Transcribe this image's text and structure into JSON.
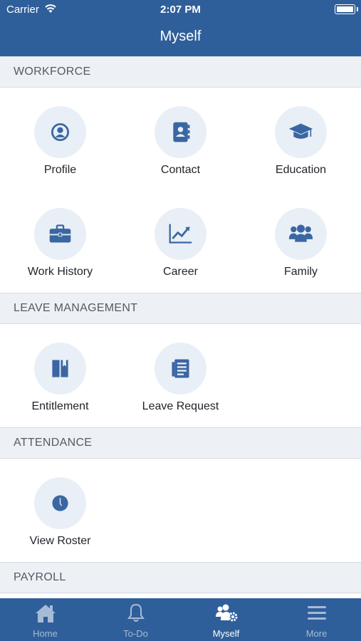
{
  "status_bar": {
    "carrier": "Carrier",
    "time": "2:07 PM"
  },
  "header": {
    "title": "Myself"
  },
  "sections": [
    {
      "title": "WORKFORCE",
      "items": [
        {
          "label": "Profile",
          "icon": "profile-icon"
        },
        {
          "label": "Contact",
          "icon": "contact-book-icon"
        },
        {
          "label": "Education",
          "icon": "graduation-cap-icon"
        },
        {
          "label": "Work History",
          "icon": "briefcase-icon"
        },
        {
          "label": "Career",
          "icon": "chart-line-icon"
        },
        {
          "label": "Family",
          "icon": "users-icon"
        }
      ]
    },
    {
      "title": "LEAVE MANAGEMENT",
      "items": [
        {
          "label": "Entitlement",
          "icon": "book-icon"
        },
        {
          "label": "Leave Request",
          "icon": "document-list-icon"
        }
      ]
    },
    {
      "title": "ATTENDANCE",
      "items": [
        {
          "label": "View Roster",
          "icon": "clock-icon"
        }
      ]
    },
    {
      "title": "PAYROLL",
      "items": []
    }
  ],
  "tab_bar": {
    "tabs": [
      {
        "label": "Home",
        "icon": "home-icon",
        "active": false
      },
      {
        "label": "To-Do",
        "icon": "bell-icon",
        "active": false
      },
      {
        "label": "Myself",
        "icon": "users-gear-icon",
        "active": true
      },
      {
        "label": "More",
        "icon": "menu-icon",
        "active": false
      }
    ]
  },
  "colors": {
    "primary": "#2f5f9a",
    "icon": "#3a67a3",
    "icon_circle": "#e9eff6",
    "section_bg": "#edf1f6",
    "tab_inactive": "#a7bbd6"
  }
}
